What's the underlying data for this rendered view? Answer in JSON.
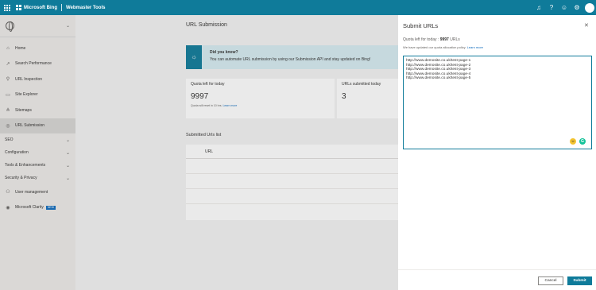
{
  "header": {
    "brand": "Microsoft Bing",
    "product": "Webmaster Tools",
    "icons": [
      "bell-icon",
      "help-icon",
      "smiley-icon",
      "settings-icon",
      "avatar"
    ]
  },
  "sidebar": {
    "items": [
      {
        "label": "Home",
        "icon": "home-icon"
      },
      {
        "label": "Search Performance",
        "icon": "trend-icon"
      },
      {
        "label": "URL Inspection",
        "icon": "search-icon"
      },
      {
        "label": "Site Explorer",
        "icon": "folder-icon"
      },
      {
        "label": "Sitemaps",
        "icon": "sitemap-icon"
      },
      {
        "label": "URL Submission",
        "icon": "globe-icon"
      }
    ],
    "groups": [
      "SEO",
      "Configuration",
      "Tools & Enhancements",
      "Security & Privacy"
    ],
    "bottom_items": [
      {
        "label": "User management",
        "icon": "users-icon"
      },
      {
        "label": "Microsoft Clarity",
        "icon": "clarity-icon",
        "badge": "NEW"
      }
    ]
  },
  "main": {
    "title": "URL Submission",
    "tip": {
      "title": "Did you know?",
      "body": "You can automate URL submission by using our Submission API and stay updated on Bing!"
    },
    "cards": [
      {
        "label": "Quota left for today",
        "value": "9997",
        "sub": "Quota will reset in 10 hrs. ",
        "sub_link": "Learn more"
      },
      {
        "label": "URLs submitted today",
        "value": "3"
      }
    ],
    "submitted_title": "Submitted Urls list",
    "table_header": "URL"
  },
  "panel": {
    "title": "Submit URLs",
    "quota_prefix": "Quota left for today : ",
    "quota_value": "9997",
    "quota_suffix": " URLs",
    "policy_text": "We have updated our quota allocation policy. ",
    "policy_link": "Learn more",
    "urls": [
      "http://www.demosite.co.uk/test-page-1",
      "http://www.demosite.co.uk/test-page-2",
      "http://www.demosite.co.uk/test-page-3",
      "http://www.demosite.co.uk/test-page-4",
      "http://www.demosite.co.uk/test-page-5"
    ],
    "cancel_label": "Cancel",
    "submit_label": "Submit"
  },
  "colors": {
    "accent": "#0f7b9a",
    "tip_bg": "#d6ecf2",
    "link": "#0f6cbd"
  }
}
